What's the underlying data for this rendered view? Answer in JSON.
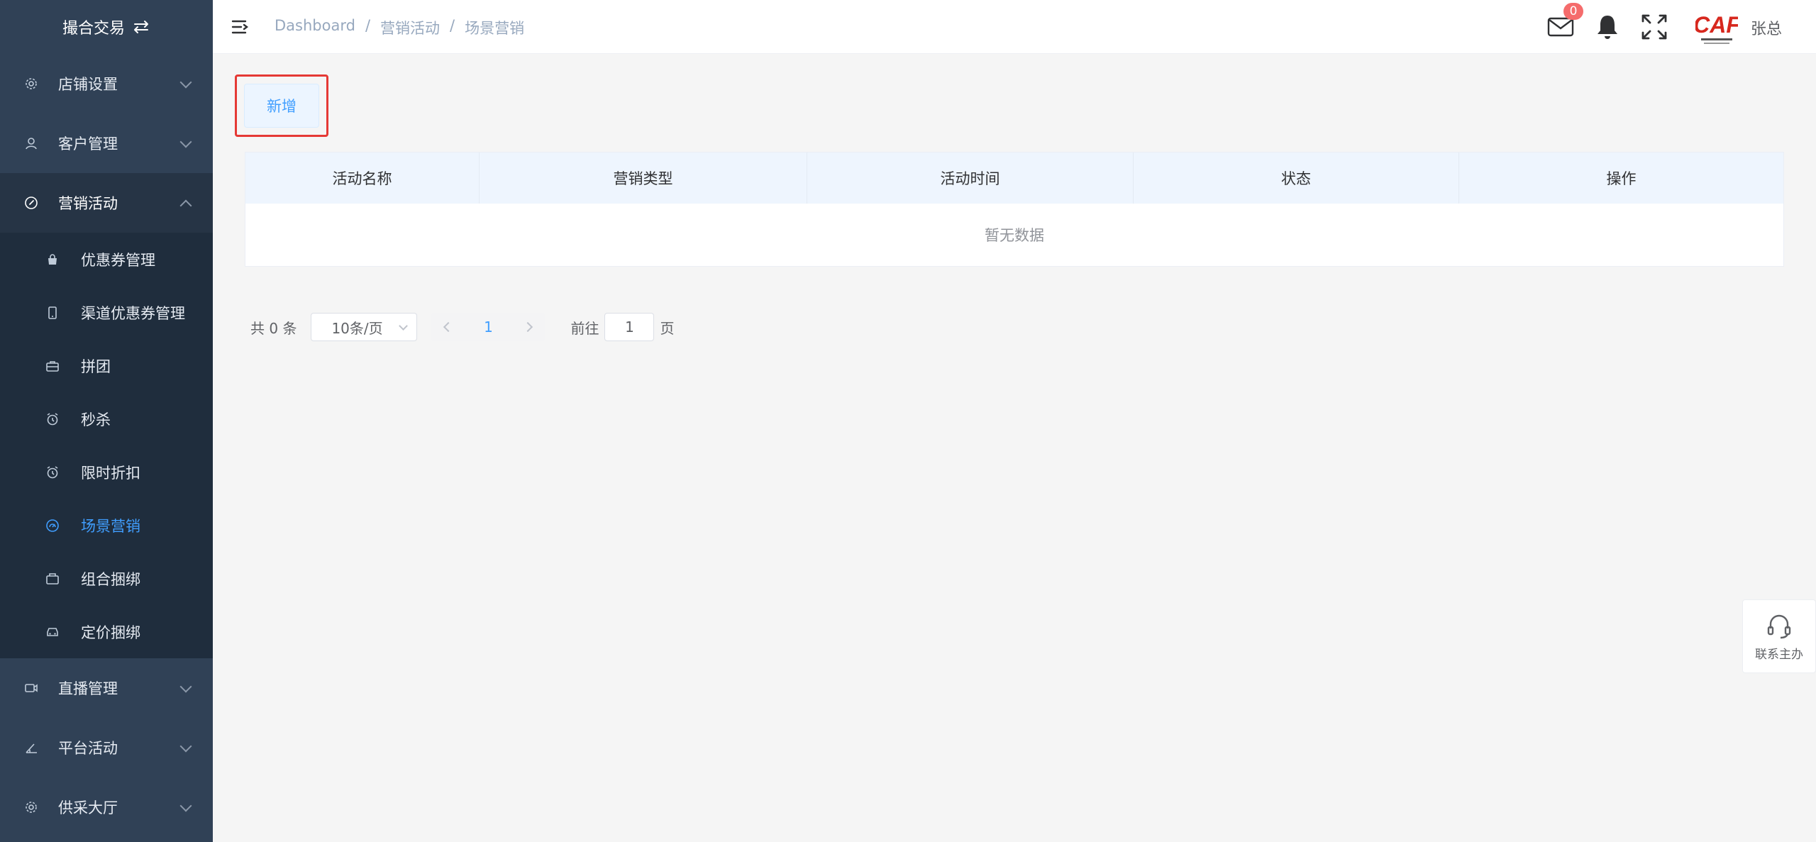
{
  "sidebar": {
    "header_title": "撮合交易",
    "menu": [
      {
        "label": "店铺设置",
        "icon": "gear-icon"
      },
      {
        "label": "客户管理",
        "icon": "user-icon"
      },
      {
        "label": "营销活动",
        "icon": "compass-icon"
      }
    ],
    "submenu": [
      {
        "label": "优惠券管理",
        "icon": "bag-icon"
      },
      {
        "label": "渠道优惠券管理",
        "icon": "phone-icon"
      },
      {
        "label": "拼团",
        "icon": "briefcase-icon"
      },
      {
        "label": "秒杀",
        "icon": "alarm-icon"
      },
      {
        "label": "限时折扣",
        "icon": "alarm-icon"
      },
      {
        "label": "场景营销",
        "icon": "gauge-icon",
        "active": true
      },
      {
        "label": "组合捆绑",
        "icon": "box-icon"
      },
      {
        "label": "定价捆绑",
        "icon": "car-icon"
      }
    ],
    "menu_bottom": [
      {
        "label": "直播管理",
        "icon": "video-icon"
      },
      {
        "label": "平台活动",
        "icon": "angle-icon"
      },
      {
        "label": "供采大厅",
        "icon": "gear-icon"
      }
    ]
  },
  "header": {
    "breadcrumb": [
      "Dashboard",
      "营销活动",
      "场景营销"
    ],
    "breadcrumb_sep": "/",
    "mail_badge": "0",
    "user_name": "张总",
    "logo_text": "CAF"
  },
  "toolbar": {
    "add_label": "新增"
  },
  "table": {
    "columns": [
      "活动名称",
      "营销类型",
      "活动时间",
      "状态",
      "操作"
    ],
    "empty_text": "暂无数据"
  },
  "pagination": {
    "total_text": "共 0 条",
    "page_size": "10条/页",
    "current_page": "1",
    "goto_label": "前往",
    "goto_value": "1",
    "page_suffix": "页"
  },
  "contact": {
    "label": "联系主办"
  },
  "colors": {
    "accent": "#409eff",
    "sidebar_bg": "#304156",
    "highlight": "#e53935"
  }
}
